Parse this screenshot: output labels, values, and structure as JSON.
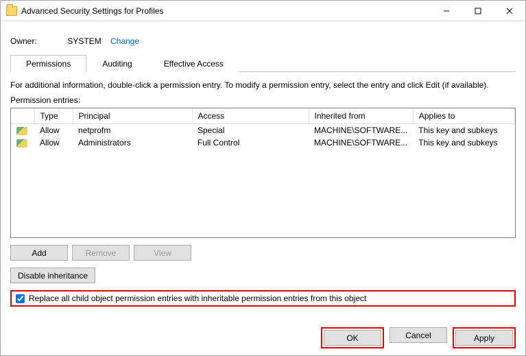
{
  "window": {
    "title": "Advanced Security Settings for Profiles"
  },
  "owner": {
    "label": "Owner:",
    "value": "SYSTEM",
    "change": "Change"
  },
  "tabs": {
    "permissions": "Permissions",
    "auditing": "Auditing",
    "effective": "Effective Access"
  },
  "info": "For additional information, double-click a permission entry. To modify a permission entry, select the entry and click Edit (if available).",
  "entries_label": "Permission entries:",
  "columns": {
    "type": "Type",
    "principal": "Principal",
    "access": "Access",
    "inherited": "Inherited from",
    "applies": "Applies to"
  },
  "rows": [
    {
      "type": "Allow",
      "principal": "netprofm",
      "access": "Special",
      "inherited": "MACHINE\\SOFTWARE...",
      "applies": "This key and subkeys"
    },
    {
      "type": "Allow",
      "principal": "Administrators",
      "access": "Full Control",
      "inherited": "MACHINE\\SOFTWARE...",
      "applies": "This key and subkeys"
    }
  ],
  "buttons": {
    "add": "Add",
    "remove": "Remove",
    "view": "View",
    "disable_inherit": "Disable inheritance",
    "ok": "OK",
    "cancel": "Cancel",
    "apply": "Apply"
  },
  "checkbox": {
    "label": "Replace all child object permission entries with inheritable permission entries from this object",
    "checked": true
  }
}
